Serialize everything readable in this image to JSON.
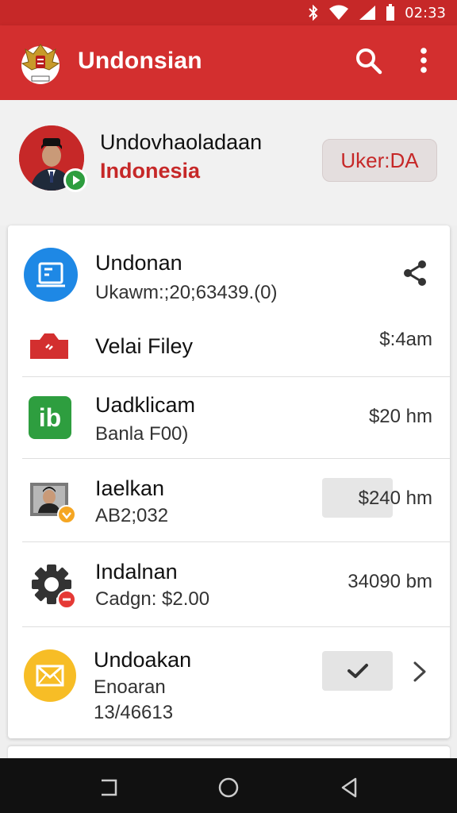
{
  "status_bar": {
    "time": "02:33",
    "icons": [
      "bluetooth-icon",
      "wifi-icon",
      "signal-icon",
      "battery-icon"
    ]
  },
  "app_bar": {
    "title": "Undonsian",
    "icons": [
      "emblem-logo",
      "search-icon",
      "more-vert-icon"
    ],
    "color": "#d32f2f"
  },
  "profile": {
    "name": "Undovhaoladaan",
    "country": "Indonesia",
    "button_label": "Uker:DA"
  },
  "card": {
    "header": {
      "title": "Undonan",
      "subtitle": "Ukawm:;20;63439.(0)"
    },
    "rows": [
      {
        "title": "Velai Filey",
        "amount": "$:4am",
        "icon": "red-tag-icon"
      },
      {
        "title": "Uadklicam",
        "subtitle": "Banla F00)",
        "amount": "$20 hm",
        "icon": "ib-app-icon"
      },
      {
        "title": "Iaelkan",
        "subtitle": "AB2;032",
        "amount": "$240 hm",
        "icon": "photo-folder-icon"
      },
      {
        "title": "Indalnan",
        "subtitle": "Cadgn: $2.00",
        "amount": "34090 bm",
        "icon": "gear-icon"
      },
      {
        "title": "Undoakan",
        "subtitle": "Enoaran",
        "subtitle2": "13/46613",
        "icon": "mail-icon"
      }
    ]
  },
  "nav": {
    "icons": [
      "recent-apps-icon",
      "home-icon",
      "back-icon"
    ]
  }
}
